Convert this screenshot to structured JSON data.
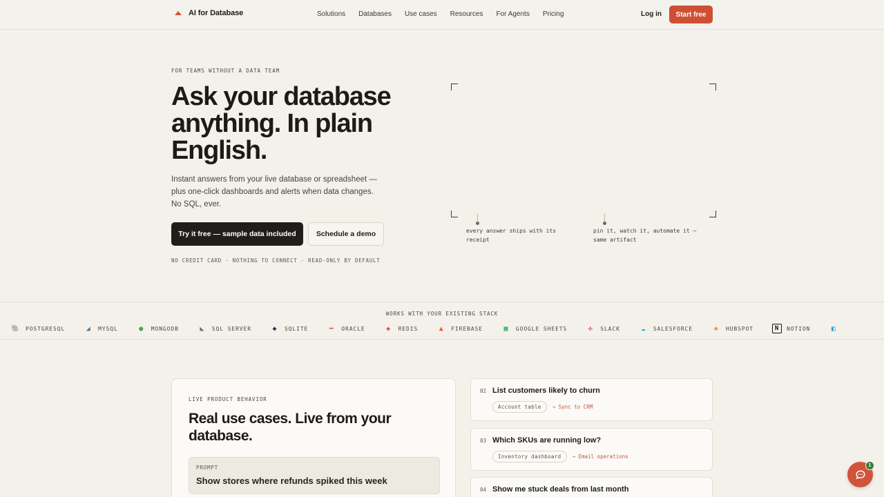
{
  "nav": {
    "brand": "AI for Database",
    "links": [
      "Solutions",
      "Databases",
      "Use cases",
      "Resources",
      "For Agents",
      "Pricing"
    ],
    "login": "Log in",
    "cta": "Start free",
    "accent": "#cf4f33"
  },
  "hero": {
    "eyebrow": "FOR TEAMS WITHOUT A DATA TEAM",
    "title": "Ask your database anything. In plain English.",
    "subtitle": "Instant answers from your live database or spreadsheet — plus one-click dashboards and alerts when data changes. No SQL, ever.",
    "primary_cta": "Try it free — sample data included",
    "secondary_cta": "Schedule a demo",
    "fineprint": "NO CREDIT CARD · NOTHING TO CONNECT · READ-ONLY BY DEFAULT",
    "captions": [
      "every answer ships with its receipt",
      "pin it, watch it, automate it — same artifact"
    ]
  },
  "stack": {
    "title": "WORKS WITH YOUR EXISTING STACK",
    "items": [
      {
        "name": "POSTGRESQL",
        "icon": "postgresql-icon",
        "color": "#336791"
      },
      {
        "name": "MYSQL",
        "icon": "mysql-icon",
        "color": "#4479a1"
      },
      {
        "name": "MONGODB",
        "icon": "mongodb-icon",
        "color": "#47a248"
      },
      {
        "name": "SQL SERVER",
        "icon": "sql-server-icon",
        "color": "#6d6d6d"
      },
      {
        "name": "SQLITE",
        "icon": "sqlite-icon",
        "color": "#1b3a5c"
      },
      {
        "name": "ORACLE",
        "icon": "oracle-icon",
        "color": "#e0594a"
      },
      {
        "name": "REDIS",
        "icon": "redis-icon",
        "color": "#dc382d"
      },
      {
        "name": "FIREBASE",
        "icon": "firebase-icon",
        "color": "#e8662f"
      },
      {
        "name": "GOOGLE SHEETS",
        "icon": "google-sheets-icon",
        "color": "#23a566"
      },
      {
        "name": "SLACK",
        "icon": "slack-icon",
        "color": "#e01e5a"
      },
      {
        "name": "SALESFORCE",
        "icon": "salesforce-icon",
        "color": "#00a1e0"
      },
      {
        "name": "HUBSPOT",
        "icon": "hubspot-icon",
        "color": "#ff7a59"
      },
      {
        "name": "NOTION",
        "icon": "notion-icon",
        "color": "#111111"
      },
      {
        "name": "",
        "icon": "airtable-icon",
        "color": "#2d9fd8"
      }
    ]
  },
  "usecases": {
    "eyebrow": "LIVE PRODUCT BEHAVIOR",
    "title": "Real use cases. Live from your database.",
    "prompt_label": "PROMPT",
    "prompt_text": "Show stores where refunds spiked this week",
    "questions": [
      {
        "num": "02",
        "title": "List customers likely to churn",
        "source": "Account table",
        "action": "→ Sync to CRM"
      },
      {
        "num": "03",
        "title": "Which SKUs are running low?",
        "source": "Inventory dashboard",
        "action": "→ Email operations"
      },
      {
        "num": "04",
        "title": "Show me stuck deals from last month",
        "source": "",
        "action": ""
      }
    ]
  },
  "chat": {
    "badge": "1"
  }
}
